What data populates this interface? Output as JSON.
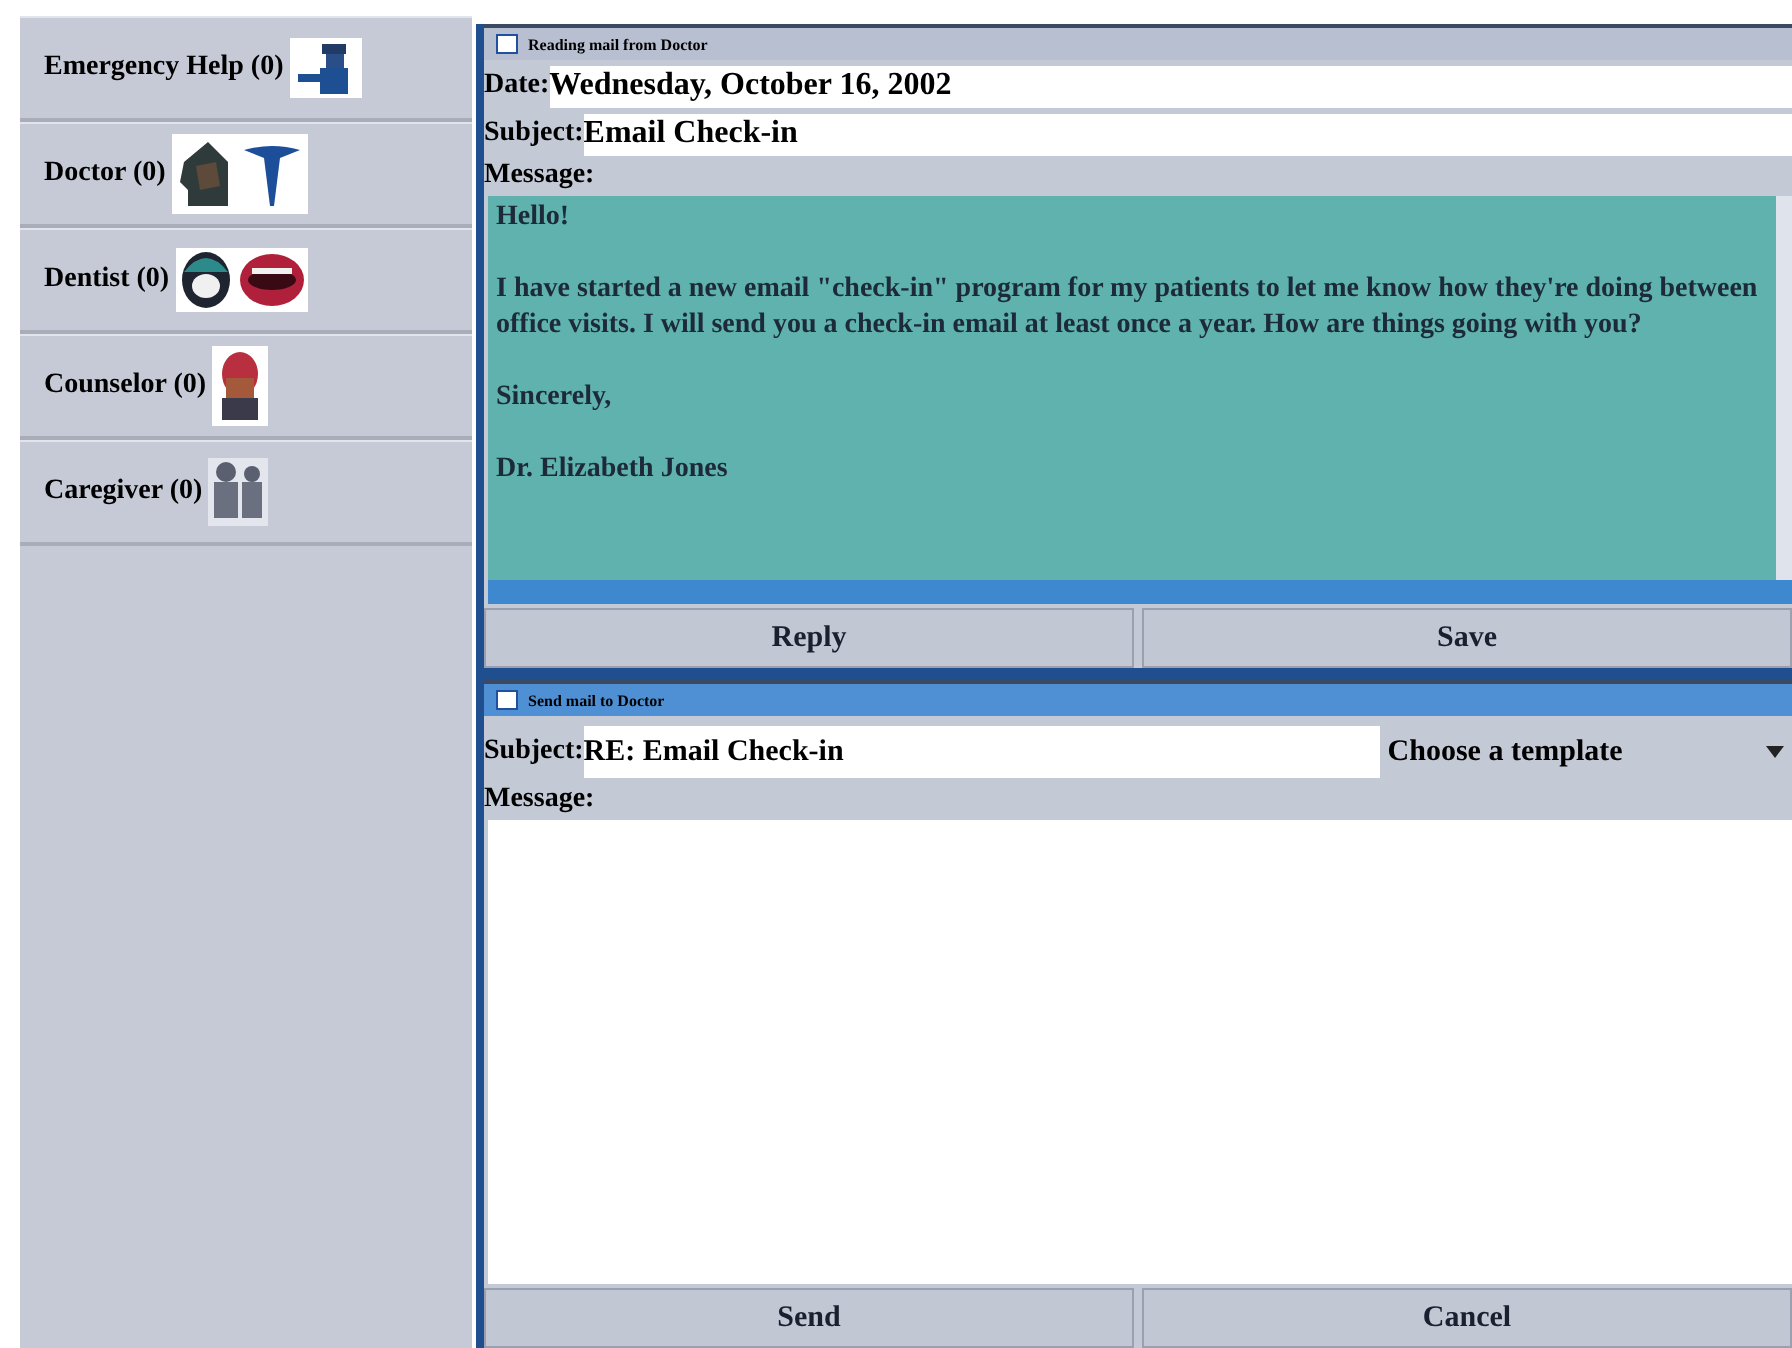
{
  "contacts": [
    {
      "kind": "emergency",
      "label": "Emergency Help (0)"
    },
    {
      "kind": "doctor",
      "label": "Doctor (0)"
    },
    {
      "kind": "dentist",
      "label": "Dentist (0)"
    },
    {
      "kind": "counselor",
      "label": "Counselor (0)"
    },
    {
      "kind": "caregiver",
      "label": "Caregiver (0)"
    }
  ],
  "reading": {
    "title": "Reading mail from Doctor",
    "date_label": "Date:",
    "date": "Wednesday, October 16, 2002",
    "subject_label": "Subject:",
    "subject": "Email Check-in",
    "message_label": "Message:",
    "message": [
      "Hello!",
      "I have started a new email \"check-in\" program for my patients to let me know how they're doing between office visits.  I will send you a check-in email at least once a year.  How are things going with you?",
      "Sincerely,",
      "Dr. Elizabeth Jones"
    ],
    "buttons": [
      "Reply",
      "Save"
    ]
  },
  "sending": {
    "title": "Send mail to Doctor",
    "subject_label": "Subject:",
    "subject": "RE: Email Check-in",
    "template": "Choose a template",
    "message_label": "Message:",
    "buttons": [
      "Send",
      "Cancel"
    ]
  }
}
